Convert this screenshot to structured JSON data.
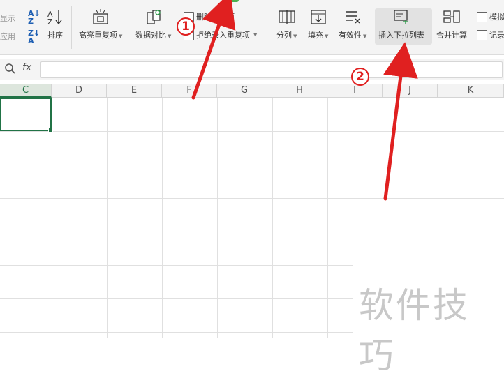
{
  "ribbon": {
    "left_partial": {
      "show_label": "显示",
      "apply_label": "应用"
    },
    "sort_label": "排序",
    "highlight_dup_label": "高亮重复项",
    "compare_label": "数据对比",
    "remove_dup_label": "删除重复项",
    "reject_dup_label": "拒绝录入重复项",
    "split_label": "分列",
    "fill_label": "填充",
    "validity_label": "有效性",
    "insert_dropdown_label": "插入下拉列表",
    "merge_calc_label": "合并计算",
    "simulate_label": "模拟",
    "record_label": "记录"
  },
  "formula_bar": {
    "fx_label": "fx",
    "value": ""
  },
  "columns": [
    "C",
    "D",
    "E",
    "F",
    "G",
    "H",
    "I",
    "J",
    "K"
  ],
  "active_column": "C",
  "annotations": {
    "marker1": "1",
    "marker2": "2",
    "arrow_color": "#e02020"
  },
  "watermark": "软件技巧"
}
